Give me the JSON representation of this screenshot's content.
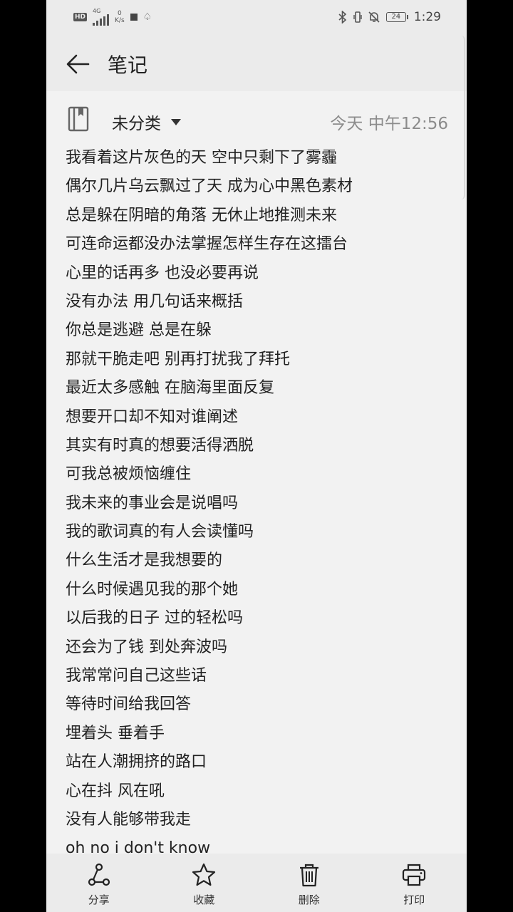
{
  "status_bar": {
    "network_badge": "HD",
    "network_gen": "4G",
    "speed_value": "0",
    "speed_unit": "K/s",
    "battery_level": "24",
    "time": "1:29"
  },
  "header": {
    "title": "笔记"
  },
  "note_meta": {
    "category": "未分类",
    "timestamp": "今天 中午12:56"
  },
  "note": {
    "lines": [
      "我看着这片灰色的天 空中只剩下了雾霾",
      "偶尔几片乌云飘过了天 成为心中黑色素材",
      "总是躲在阴暗的角落 无休止地推测未来",
      "可连命运都没办法掌握怎样生存在这擂台",
      "心里的话再多 也没必要再说",
      "没有办法 用几句话来概括",
      "你总是逃避 总是在躲",
      "那就干脆走吧 别再打扰我了拜托",
      "最近太多感触 在脑海里面反复",
      "想要开口却不知对谁阐述",
      "其实有时真的想要活得洒脱",
      "可我总被烦恼缠住",
      "我未来的事业会是说唱吗",
      "我的歌词真的有人会读懂吗",
      "什么生活才是我想要的",
      "什么时候遇见我的那个她",
      "以后我的日子 过的轻松吗",
      "还会为了钱 到处奔波吗",
      "我常常问自己这些话",
      "等待时间给我回答",
      "埋着头 垂着手",
      "站在人潮拥挤的路口",
      "心在抖 风在吼",
      "没有人能够带我走",
      "oh no i don't know"
    ]
  },
  "toolbar": {
    "share": "分享",
    "favorite": "收藏",
    "delete": "删除",
    "print": "打印"
  },
  "colors": {
    "background": "#f2f2f2",
    "bars": "#ebebeb",
    "text": "#222222",
    "muted": "#8c8c8c"
  }
}
